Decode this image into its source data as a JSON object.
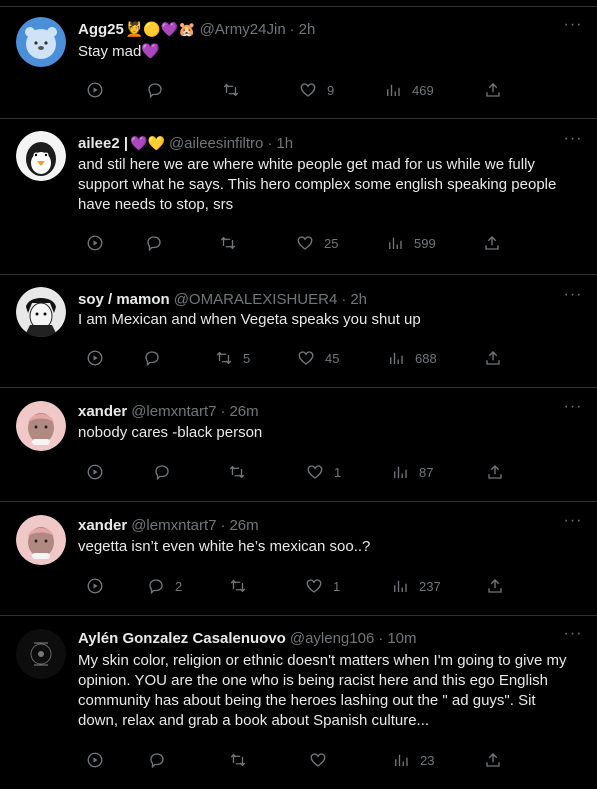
{
  "tweets": [
    {
      "name": "Agg25",
      "emoji": "💆🟡💜🐹",
      "handle": "@Army24Jin",
      "time": "2h",
      "text": [
        "Stay mad💜"
      ],
      "replies": "",
      "retweets": "",
      "likes": "9",
      "views": "469",
      "avatar_color": "#4a90d9"
    },
    {
      "name": "ailee2 |",
      "emoji": "💜💛",
      "handle": "@aileesinfiltro",
      "time": "1h",
      "text": [
        "and stil here we are where white people get mad for us while we fully",
        "support what he says. This hero complex some english speaking people",
        "have needs to stop, srs"
      ],
      "replies": "",
      "retweets": "",
      "likes": "25",
      "views": "599",
      "avatar_color": "#f2f2f2"
    },
    {
      "name": "soy / mamon",
      "emoji": "",
      "handle": "@OMARALEXISHUER4",
      "time": "2h",
      "text": [
        "I am Mexican and when Vegeta speaks you shut up"
      ],
      "replies": "",
      "retweets": "5",
      "likes": "45",
      "views": "688",
      "avatar_color": "#ddd"
    },
    {
      "name": "xander",
      "emoji": "",
      "handle": "@lemxntart7",
      "time": "26m",
      "text": [
        "nobody cares -black person"
      ],
      "replies": "",
      "retweets": "",
      "likes": "1",
      "views": "87",
      "avatar_color": "#e8b8b8"
    },
    {
      "name": "xander",
      "emoji": "",
      "handle": "@lemxntart7",
      "time": "26m",
      "text": [
        "vegetta isn’t even white he’s mexican soo..?"
      ],
      "replies": "2",
      "retweets": "",
      "likes": "1",
      "views": "237",
      "avatar_color": "#e8b8b8"
    },
    {
      "name": "Aylén Gonzalez Casalenuovo",
      "emoji": "",
      "handle": "@ayleng106",
      "time": "10m",
      "text": [
        "My skin color, religion or ethnic doesn't matters when I'm going to give my",
        "opinion. YOU are the one who is being racist here and this ego English",
        "community has about being the heroes lashing out the \" ad guys\". Sit",
        "down, relax and grab a book about Spanish culture..."
      ],
      "replies": "",
      "retweets": "",
      "likes": "",
      "views": "23",
      "avatar_color": "#111"
    }
  ]
}
